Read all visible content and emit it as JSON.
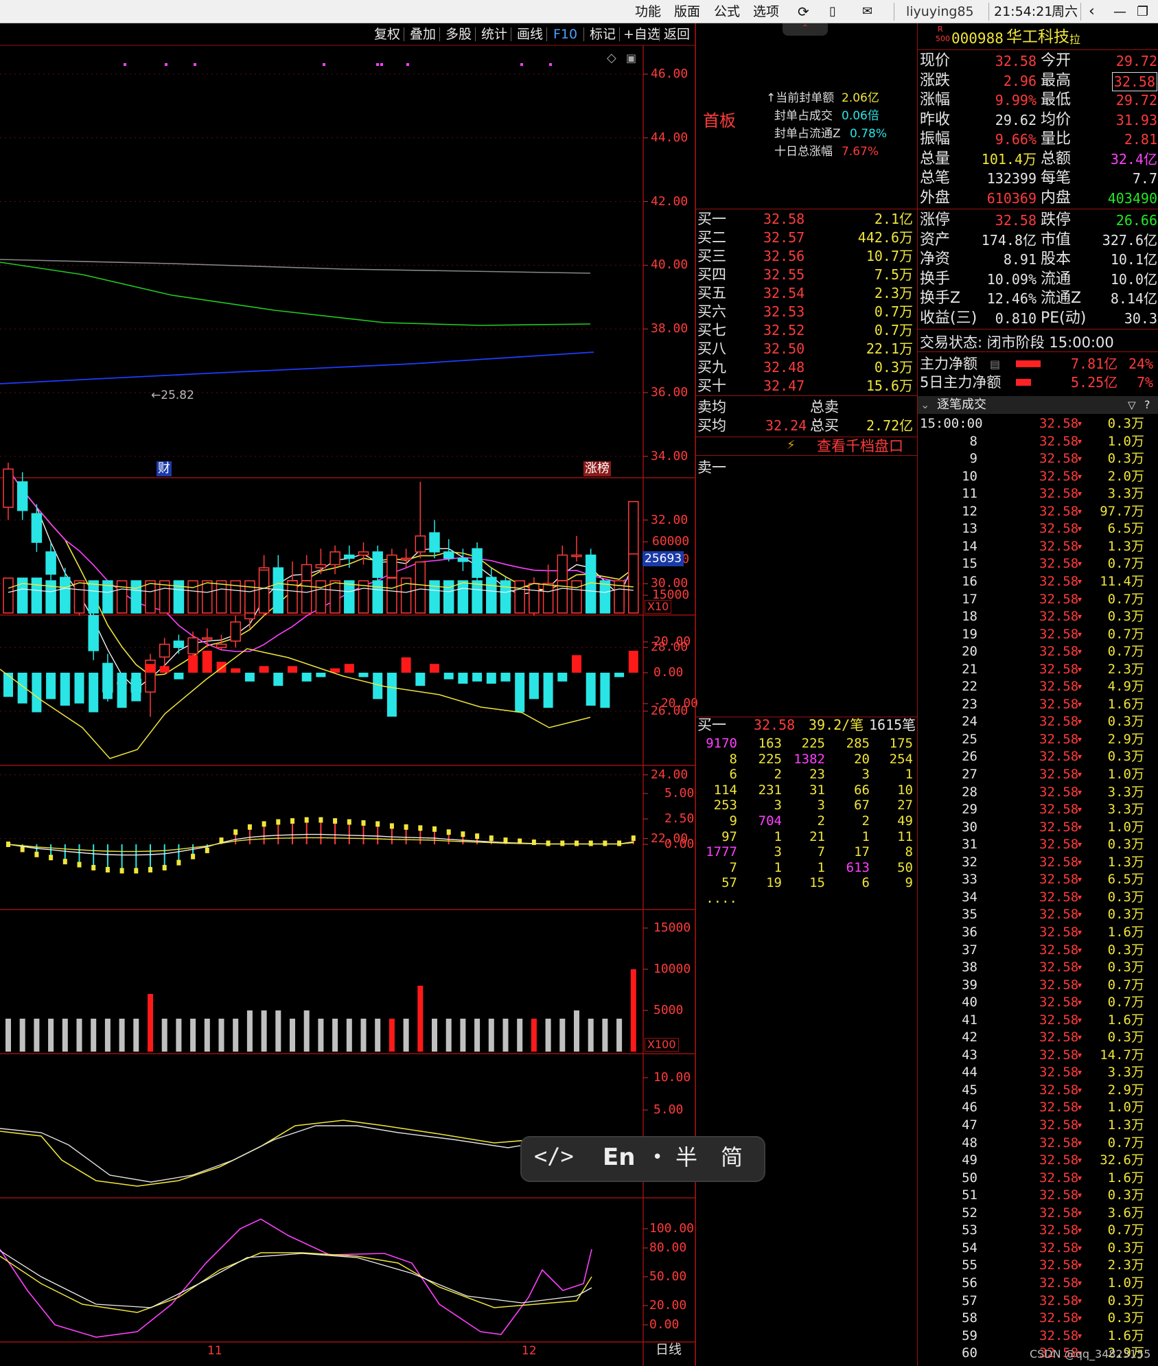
{
  "topbar": {
    "menus": [
      "功能",
      "版面",
      "公式",
      "选项"
    ],
    "user": "liyuying85",
    "clock": "21:54:21",
    "weekday": "周六"
  },
  "chart_toolbar": [
    "复权",
    "叠加",
    "多股",
    "统计",
    "画线",
    "F10",
    "标记",
    "+自选",
    "返回"
  ],
  "stock": {
    "badge_top": "R",
    "badge_bottom": "500",
    "code": "000988",
    "name": "华工科技",
    "tag": "拉"
  },
  "seal": {
    "label": "首板",
    "rows": [
      {
        "l": "当前封单额",
        "v": "2.06亿"
      },
      {
        "l": "封单占成交",
        "v": "0.06倍"
      },
      {
        "l": "封单占流通Z",
        "v": "0.78%"
      },
      {
        "l": "十日总涨幅",
        "v": "7.67%"
      }
    ]
  },
  "quote": [
    {
      "l1": "现价",
      "v1": "32.58",
      "l2": "今开",
      "v2": "29.72"
    },
    {
      "l1": "涨跌",
      "v1": "2.96",
      "l2": "最高",
      "v2": "32.58"
    },
    {
      "l1": "涨幅",
      "v1": "9.99%",
      "l2": "最低",
      "v2": "29.72"
    },
    {
      "l1": "昨收",
      "v1": "29.62",
      "l2": "均价",
      "v2": "31.93"
    },
    {
      "l1": "振幅",
      "v1": "9.66%",
      "l2": "量比",
      "v2": "2.81"
    },
    {
      "l1": "总量",
      "v1": "101.4万",
      "l2": "总额",
      "v2": "32.4亿"
    },
    {
      "l1": "总笔",
      "v1": "132399",
      "l2": "每笔",
      "v2": "7.7"
    },
    {
      "l1": "外盘",
      "v1": "610369",
      "l2": "内盘",
      "v2": "403490"
    }
  ],
  "quote2": [
    {
      "l1": "涨停",
      "v1": "32.58",
      "l2": "跌停",
      "v2": "26.66"
    },
    {
      "l1": "资产",
      "v1": "174.8亿",
      "l2": "市值",
      "v2": "327.6亿"
    },
    {
      "l1": "净资",
      "v1": "8.91",
      "l2": "股本",
      "v2": "10.1亿"
    },
    {
      "l1": "换手",
      "v1": "10.09%",
      "l2": "流通",
      "v2": "10.0亿"
    },
    {
      "l1": "换手Z",
      "v1": "12.46%",
      "l2": "流通Z",
      "v2": "8.14亿"
    },
    {
      "l1": "收益(三)",
      "v1": "0.810",
      "l2": "PE(动)",
      "v2": "30.3"
    }
  ],
  "trade_status": "交易状态: 闭市阶段 15:00:00",
  "mainforce": [
    {
      "l": "主力净额",
      "v": "7.81亿",
      "p": "24%"
    },
    {
      "l": "5日主力净额",
      "v": "5.25亿",
      "p": "7%"
    }
  ],
  "ticks_header": "逐笔成交",
  "ticks_first": "15:00:00",
  "ticks_price": "32.58",
  "ticks": [
    [
      "",
      "0.3万"
    ],
    [
      "8",
      "1.0万"
    ],
    [
      "9",
      "0.3万"
    ],
    [
      "10",
      "2.0万"
    ],
    [
      "11",
      "3.3万"
    ],
    [
      "12",
      "97.7万"
    ],
    [
      "13",
      "6.5万"
    ],
    [
      "14",
      "1.3万"
    ],
    [
      "15",
      "0.7万"
    ],
    [
      "16",
      "11.4万"
    ],
    [
      "17",
      "0.7万"
    ],
    [
      "18",
      "0.3万"
    ],
    [
      "19",
      "0.7万"
    ],
    [
      "20",
      "0.7万"
    ],
    [
      "21",
      "2.3万"
    ],
    [
      "22",
      "4.9万"
    ],
    [
      "23",
      "1.6万"
    ],
    [
      "24",
      "0.3万"
    ],
    [
      "25",
      "2.9万"
    ],
    [
      "26",
      "0.3万"
    ],
    [
      "27",
      "1.0万"
    ],
    [
      "28",
      "3.3万"
    ],
    [
      "29",
      "3.3万"
    ],
    [
      "30",
      "1.0万"
    ],
    [
      "31",
      "0.3万"
    ],
    [
      "32",
      "1.3万"
    ],
    [
      "33",
      "6.5万"
    ],
    [
      "34",
      "0.3万"
    ],
    [
      "35",
      "0.3万"
    ],
    [
      "36",
      "1.6万"
    ],
    [
      "37",
      "0.3万"
    ],
    [
      "38",
      "0.3万"
    ],
    [
      "39",
      "0.7万"
    ],
    [
      "40",
      "0.7万"
    ],
    [
      "41",
      "1.6万"
    ],
    [
      "42",
      "0.3万"
    ],
    [
      "43",
      "14.7万"
    ],
    [
      "44",
      "3.3万"
    ],
    [
      "45",
      "2.9万"
    ],
    [
      "46",
      "1.0万"
    ],
    [
      "47",
      "1.3万"
    ],
    [
      "48",
      "0.7万"
    ],
    [
      "49",
      "32.6万"
    ],
    [
      "50",
      "1.6万"
    ],
    [
      "51",
      "0.3万"
    ],
    [
      "52",
      "3.6万"
    ],
    [
      "53",
      "0.7万"
    ],
    [
      "54",
      "0.3万"
    ],
    [
      "55",
      "2.3万"
    ],
    [
      "56",
      "1.0万"
    ],
    [
      "57",
      "0.3万"
    ],
    [
      "58",
      "0.3万"
    ],
    [
      "59",
      "1.6万"
    ],
    [
      "60",
      "2.9万"
    ]
  ],
  "bids": [
    {
      "l": "买一",
      "p": "32.58",
      "v": "2.1亿"
    },
    {
      "l": "买二",
      "p": "32.57",
      "v": "442.6万"
    },
    {
      "l": "买三",
      "p": "32.56",
      "v": "10.7万"
    },
    {
      "l": "买四",
      "p": "32.55",
      "v": "7.5万"
    },
    {
      "l": "买五",
      "p": "32.54",
      "v": "2.3万"
    },
    {
      "l": "买六",
      "p": "32.53",
      "v": "0.7万"
    },
    {
      "l": "买七",
      "p": "32.52",
      "v": "0.7万"
    },
    {
      "l": "买八",
      "p": "32.50",
      "v": "22.1万"
    },
    {
      "l": "买九",
      "p": "32.48",
      "v": "0.3万"
    },
    {
      "l": "买十",
      "p": "32.47",
      "v": "15.6万"
    }
  ],
  "avg_rows": [
    {
      "l": "卖均",
      "p": "",
      "l2": "总卖",
      "v": ""
    },
    {
      "l": "买均",
      "p": "32.24",
      "l2": "总买",
      "v": "2.72亿"
    }
  ],
  "depth_link": "查看千档盘口",
  "sell1": "卖一",
  "queue": {
    "label": "买一",
    "price": "32.58",
    "per": "39.2/笔",
    "count": "1615笔",
    "rows": [
      [
        "9170",
        "163",
        "225",
        "285",
        "175"
      ],
      [
        "8",
        "225",
        "1382",
        "20",
        "254"
      ],
      [
        "6",
        "2",
        "23",
        "3",
        "1"
      ],
      [
        "114",
        "231",
        "31",
        "66",
        "10"
      ],
      [
        "253",
        "3",
        "3",
        "67",
        "27"
      ],
      [
        "9",
        "704",
        "2",
        "2",
        "49"
      ],
      [
        "97",
        "1",
        "21",
        "1",
        "11"
      ],
      [
        "1777",
        "3",
        "7",
        "17",
        "8"
      ],
      [
        "7",
        "1",
        "1",
        "613",
        "50"
      ],
      [
        "57",
        "19",
        "15",
        "6",
        "9"
      ],
      [
        "....",
        "",
        "",
        "",
        ""
      ]
    ]
  },
  "chart_data": {
    "type": "candlestick",
    "price_axis": [
      "46.00",
      "44.00",
      "42.00",
      "40.00",
      "38.00",
      "36.00",
      "34.00",
      "32.00",
      "30.00",
      "28.00",
      "26.00",
      "24.00",
      "22.00"
    ],
    "low_label": "25.82",
    "markers": [
      "财",
      "涨榜"
    ],
    "vol_axis": [
      "60000",
      "45000",
      "15000"
    ],
    "vol_flag": "25693",
    "vol_unit": "X10",
    "mf_axis": [
      "20.00",
      "0.00",
      "-20.00"
    ],
    "macd_axis": [
      "5.00",
      "2.50",
      "0.00"
    ],
    "cnt_axis": [
      "15000",
      "10000",
      "5000"
    ],
    "cnt_unit": "X100",
    "kd_axis": [
      "10.00",
      "5.00"
    ],
    "rsi_axis": [
      "100.00",
      "80.00",
      "50.00",
      "20.00",
      "0.00"
    ],
    "x_labels": [
      "11",
      "12"
    ],
    "period": "日线",
    "candles": [
      [
        32.4,
        33.6,
        33.8,
        32.0
      ],
      [
        33.2,
        32.3,
        33.5,
        32.0
      ],
      [
        32.2,
        31.3,
        32.5,
        31.0
      ],
      [
        31.0,
        30.3,
        31.3,
        30.0
      ],
      [
        30.2,
        29.4,
        30.5,
        29.2
      ],
      [
        29.3,
        29.3,
        29.6,
        29.0
      ],
      [
        29.0,
        27.9,
        29.2,
        27.6
      ],
      [
        27.5,
        26.6,
        27.8,
        26.3
      ],
      [
        26.9,
        26.9,
        27.1,
        26.7
      ],
      [
        27.0,
        26.6,
        27.2,
        26.4
      ],
      [
        26.6,
        27.6,
        27.8,
        25.82
      ],
      [
        27.7,
        28.1,
        28.3,
        27.4
      ],
      [
        28.2,
        28.0,
        28.4,
        27.8
      ],
      [
        27.8,
        28.3,
        28.5,
        27.6
      ],
      [
        28.3,
        28.3,
        28.6,
        28.0
      ],
      [
        28.0,
        28.1,
        28.4,
        27.9
      ],
      [
        28.2,
        28.8,
        29.0,
        28.0
      ],
      [
        28.9,
        29.3,
        29.5,
        28.6
      ],
      [
        29.2,
        30.5,
        30.9,
        29.0
      ],
      [
        30.5,
        30.2,
        30.9,
        30.0
      ],
      [
        30.1,
        30.1,
        30.7,
        29.9
      ],
      [
        30.1,
        30.6,
        30.9,
        30.0
      ],
      [
        30.5,
        30.6,
        31.1,
        30.3
      ],
      [
        30.6,
        31.0,
        31.2,
        30.3
      ],
      [
        30.9,
        30.8,
        31.2,
        30.5
      ],
      [
        30.9,
        31.0,
        31.3,
        30.6
      ],
      [
        31.0,
        30.2,
        31.2,
        30.0
      ],
      [
        30.2,
        30.9,
        31.1,
        30.1
      ],
      [
        30.8,
        30.8,
        31.1,
        30.5
      ],
      [
        31.0,
        31.5,
        33.2,
        30.8
      ],
      [
        31.6,
        31.0,
        32.0,
        30.8
      ],
      [
        31.0,
        30.8,
        31.4,
        30.7
      ],
      [
        30.8,
        30.7,
        31.1,
        30.4
      ],
      [
        31.1,
        30.2,
        31.3,
        30.0
      ],
      [
        30.2,
        29.8,
        30.5,
        29.6
      ],
      [
        29.9,
        29.6,
        30.2,
        29.3
      ],
      [
        29.6,
        29.6,
        29.9,
        29.3
      ],
      [
        29.3,
        30.0,
        30.2,
        29.0
      ],
      [
        30.0,
        30.0,
        30.6,
        29.6
      ],
      [
        30.1,
        30.9,
        31.2,
        29.9
      ],
      [
        30.9,
        30.9,
        31.5,
        30.7
      ],
      [
        30.9,
        29.7,
        31.1,
        29.5
      ],
      [
        29.8,
        29.6,
        30.0,
        29.3
      ],
      [
        29.3,
        29.6,
        29.9,
        29.2
      ],
      [
        29.72,
        32.58,
        32.58,
        29.72
      ]
    ],
    "volume": [
      13,
      13,
      13,
      12,
      12,
      12,
      12,
      12,
      12,
      12,
      12,
      12,
      12,
      12,
      12,
      12,
      12,
      12,
      16,
      13,
      12,
      12,
      12,
      12,
      12,
      12,
      12,
      13,
      13,
      19,
      12,
      12,
      12,
      12,
      12,
      12,
      12,
      11,
      11,
      12,
      12,
      11,
      12,
      12,
      22
    ],
    "moneyflow": [
      -11,
      -14,
      -18,
      -12,
      -15,
      -14,
      -18,
      -12,
      -16,
      -13,
      4,
      3,
      -3,
      8,
      10,
      5,
      2,
      -4,
      3,
      -6,
      3,
      -4,
      -2,
      2,
      4,
      -2,
      -12,
      -20,
      7,
      -6,
      4,
      -3,
      -5,
      -4,
      -5,
      -4,
      -18,
      -12,
      -16,
      -4,
      8,
      -15,
      -16,
      -2,
      10
    ],
    "macd": [
      0,
      -0.5,
      -1.0,
      -1.3,
      -1.7,
      -2.0,
      -2.3,
      -2.5,
      -2.6,
      -2.6,
      -2.5,
      -2.3,
      -1.8,
      -1.2,
      -0.6,
      0.4,
      1.2,
      1.7,
      2.0,
      2.2,
      2.3,
      2.4,
      2.4,
      2.3,
      2.2,
      2.1,
      2.0,
      1.8,
      1.7,
      1.6,
      1.5,
      1.2,
      1.0,
      0.8,
      0.6,
      0.4,
      0.3,
      0.2,
      0.1,
      0.1,
      0.1,
      0.1,
      0.1,
      0.1,
      0.6
    ],
    "tradecount": [
      4,
      4,
      4,
      4,
      4,
      4,
      4,
      4,
      4,
      4,
      7,
      4,
      4,
      4,
      4,
      4,
      4,
      5,
      5,
      5,
      4,
      5,
      4,
      4,
      4,
      4,
      4,
      4,
      4,
      8,
      4,
      4,
      4,
      4,
      4,
      4,
      4,
      4,
      4,
      4,
      5,
      4,
      4,
      4,
      10
    ]
  },
  "ime": {
    "code": "</>",
    "lang": "En",
    "dot": "•",
    "half": "半",
    "simp": "简"
  },
  "watermark": "CSDN @qq_34823155"
}
